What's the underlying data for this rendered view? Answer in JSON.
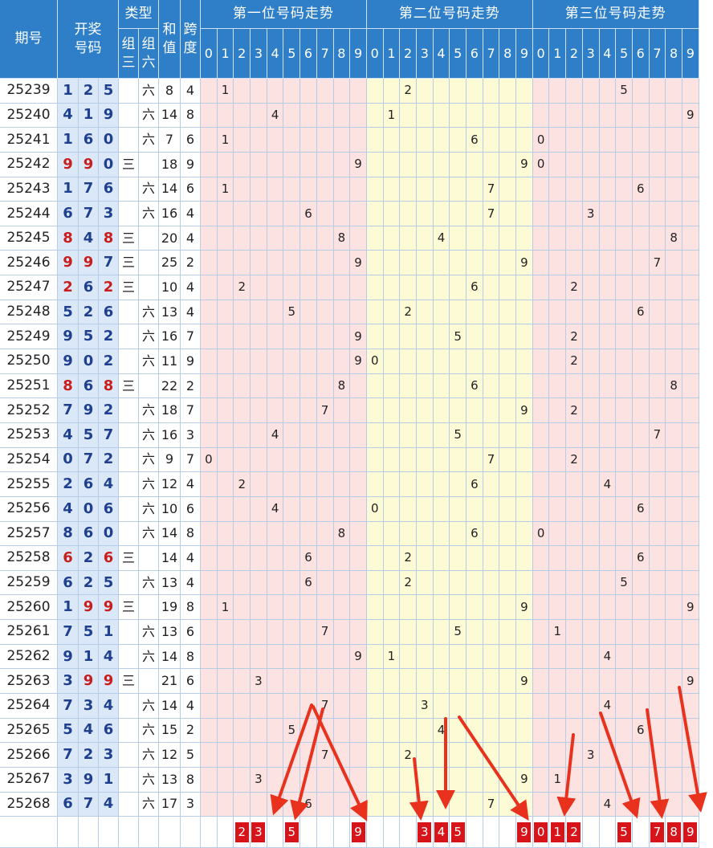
{
  "headers": {
    "issue": "期号",
    "draw_line1": "开奖",
    "draw_line2": "号码",
    "type": "类型",
    "type_sub1_a": "组",
    "type_sub1_b": "三",
    "type_sub2_a": "组",
    "type_sub2_b": "六",
    "sum_a": "和",
    "sum_b": "值",
    "span_a": "跨",
    "span_b": "度",
    "sections": [
      "第一位号码走势",
      "第二位号码走势",
      "第三位号码走势"
    ],
    "digits": [
      "0",
      "1",
      "2",
      "3",
      "4",
      "5",
      "6",
      "7",
      "8",
      "9"
    ]
  },
  "type_labels": {
    "z3": "三",
    "z6": "六"
  },
  "rows": [
    {
      "issue": "25239",
      "nums": [
        1,
        2,
        5
      ],
      "type": "z6",
      "sum": 8,
      "span": 4
    },
    {
      "issue": "25240",
      "nums": [
        4,
        1,
        9
      ],
      "type": "z6",
      "sum": 14,
      "span": 8
    },
    {
      "issue": "25241",
      "nums": [
        1,
        6,
        0
      ],
      "type": "z6",
      "sum": 7,
      "span": 6
    },
    {
      "issue": "25242",
      "nums": [
        9,
        9,
        0
      ],
      "type": "z3",
      "sum": 18,
      "span": 9
    },
    {
      "issue": "25243",
      "nums": [
        1,
        7,
        6
      ],
      "type": "z6",
      "sum": 14,
      "span": 6
    },
    {
      "issue": "25244",
      "nums": [
        6,
        7,
        3
      ],
      "type": "z6",
      "sum": 16,
      "span": 4
    },
    {
      "issue": "25245",
      "nums": [
        8,
        4,
        8
      ],
      "type": "z3",
      "sum": 20,
      "span": 4
    },
    {
      "issue": "25246",
      "nums": [
        9,
        9,
        7
      ],
      "type": "z3",
      "sum": 25,
      "span": 2
    },
    {
      "issue": "25247",
      "nums": [
        2,
        6,
        2
      ],
      "type": "z3",
      "sum": 10,
      "span": 4
    },
    {
      "issue": "25248",
      "nums": [
        5,
        2,
        6
      ],
      "type": "z6",
      "sum": 13,
      "span": 4
    },
    {
      "issue": "25249",
      "nums": [
        9,
        5,
        2
      ],
      "type": "z6",
      "sum": 16,
      "span": 7
    },
    {
      "issue": "25250",
      "nums": [
        9,
        0,
        2
      ],
      "type": "z6",
      "sum": 11,
      "span": 9
    },
    {
      "issue": "25251",
      "nums": [
        8,
        6,
        8
      ],
      "type": "z3",
      "sum": 22,
      "span": 2
    },
    {
      "issue": "25252",
      "nums": [
        7,
        9,
        2
      ],
      "type": "z6",
      "sum": 18,
      "span": 7
    },
    {
      "issue": "25253",
      "nums": [
        4,
        5,
        7
      ],
      "type": "z6",
      "sum": 16,
      "span": 3
    },
    {
      "issue": "25254",
      "nums": [
        0,
        7,
        2
      ],
      "type": "z6",
      "sum": 9,
      "span": 7
    },
    {
      "issue": "25255",
      "nums": [
        2,
        6,
        4
      ],
      "type": "z6",
      "sum": 12,
      "span": 4
    },
    {
      "issue": "25256",
      "nums": [
        4,
        0,
        6
      ],
      "type": "z6",
      "sum": 10,
      "span": 6
    },
    {
      "issue": "25257",
      "nums": [
        8,
        6,
        0
      ],
      "type": "z6",
      "sum": 14,
      "span": 8
    },
    {
      "issue": "25258",
      "nums": [
        6,
        2,
        6
      ],
      "type": "z3",
      "sum": 14,
      "span": 4
    },
    {
      "issue": "25259",
      "nums": [
        6,
        2,
        5
      ],
      "type": "z6",
      "sum": 13,
      "span": 4
    },
    {
      "issue": "25260",
      "nums": [
        1,
        9,
        9
      ],
      "type": "z3",
      "sum": 19,
      "span": 8
    },
    {
      "issue": "25261",
      "nums": [
        7,
        5,
        1
      ],
      "type": "z6",
      "sum": 13,
      "span": 6
    },
    {
      "issue": "25262",
      "nums": [
        9,
        1,
        4
      ],
      "type": "z6",
      "sum": 14,
      "span": 8
    },
    {
      "issue": "25263",
      "nums": [
        3,
        9,
        9
      ],
      "type": "z3",
      "sum": 21,
      "span": 6
    },
    {
      "issue": "25264",
      "nums": [
        7,
        3,
        4
      ],
      "type": "z6",
      "sum": 14,
      "span": 4
    },
    {
      "issue": "25265",
      "nums": [
        5,
        4,
        6
      ],
      "type": "z6",
      "sum": 15,
      "span": 2
    },
    {
      "issue": "25266",
      "nums": [
        7,
        2,
        3
      ],
      "type": "z6",
      "sum": 12,
      "span": 5
    },
    {
      "issue": "25267",
      "nums": [
        3,
        9,
        1
      ],
      "type": "z6",
      "sum": 13,
      "span": 8
    },
    {
      "issue": "25268",
      "nums": [
        6,
        7,
        4
      ],
      "type": "z6",
      "sum": 17,
      "span": 3
    }
  ],
  "predictions": [
    [
      2,
      3,
      5,
      9
    ],
    [
      3,
      4,
      5,
      9
    ],
    [
      0,
      1,
      2,
      5,
      7,
      8,
      9
    ]
  ],
  "colors": {
    "header_blue": "#2e7fc7",
    "draw_bg": "#dbe8f8",
    "number_blue": "#1f3f8f",
    "repeat_red": "#c81e1e",
    "pos1_bg": "#fde2e2",
    "pos2_bg": "#fdfbd5",
    "pos3_bg": "#fde2e2",
    "mark_red": "#d7141a",
    "arrow_red": "#e8321e"
  }
}
